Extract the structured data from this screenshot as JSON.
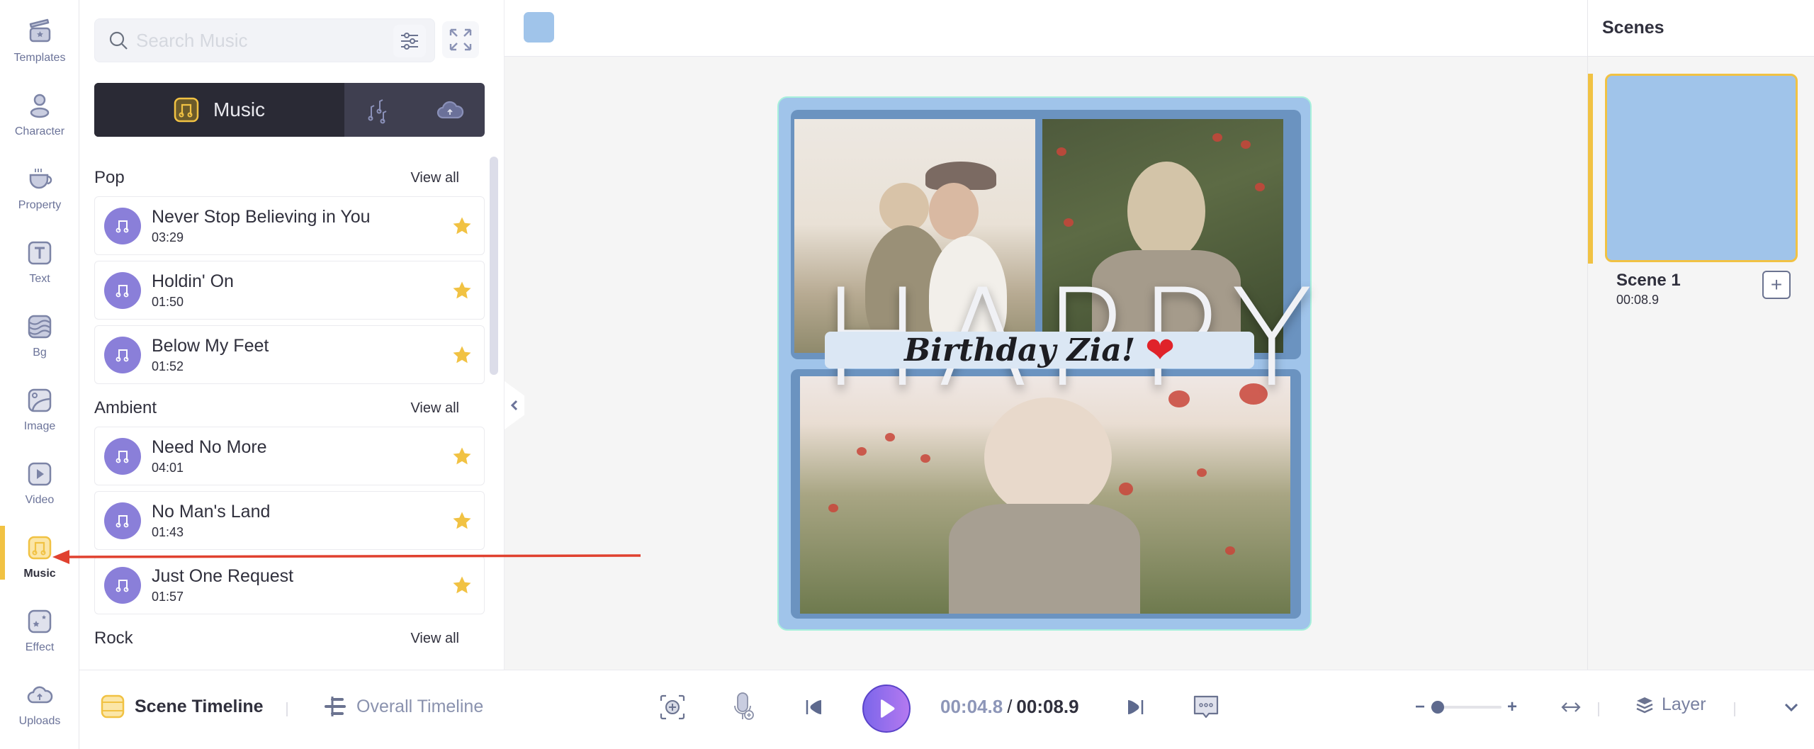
{
  "nav": {
    "items": [
      {
        "label": "Templates",
        "icon": "clapperboard-star-icon",
        "active": false
      },
      {
        "label": "Character",
        "icon": "person-icon",
        "active": false
      },
      {
        "label": "Property",
        "icon": "coffee-cup-icon",
        "active": false
      },
      {
        "label": "Text",
        "icon": "text-t-icon",
        "active": false
      },
      {
        "label": "Bg",
        "icon": "waves-background-icon",
        "active": false
      },
      {
        "label": "Image",
        "icon": "image-icon",
        "active": false
      },
      {
        "label": "Video",
        "icon": "play-video-icon",
        "active": false
      },
      {
        "label": "Music",
        "icon": "music-note-icon",
        "active": true
      },
      {
        "label": "Effect",
        "icon": "sparkle-effect-icon",
        "active": false
      },
      {
        "label": "Uploads",
        "icon": "cloud-upload-icon",
        "active": false
      }
    ]
  },
  "library": {
    "search": {
      "placeholder": "Search Music",
      "value": ""
    },
    "tabs": [
      {
        "label": "Music",
        "icon": "music-note-icon",
        "active": true
      },
      {
        "label": "",
        "icon": "sound-effects-icon",
        "active": false
      },
      {
        "label": "",
        "icon": "cloud-upload-icon",
        "active": false
      }
    ],
    "sections": [
      {
        "title": "Pop",
        "view_all": "View all",
        "tracks": [
          {
            "title": "Never Stop Believing in You",
            "duration": "03:29",
            "starred": true
          },
          {
            "title": "Holdin' On",
            "duration": "01:50",
            "starred": true
          },
          {
            "title": "Below My Feet",
            "duration": "01:52",
            "starred": true
          }
        ]
      },
      {
        "title": "Ambient",
        "view_all": "View all",
        "tracks": [
          {
            "title": "Need No More",
            "duration": "04:01",
            "starred": true
          },
          {
            "title": "No Man's Land",
            "duration": "01:43",
            "starred": true
          },
          {
            "title": "Just One Request",
            "duration": "01:57",
            "starred": true
          }
        ]
      },
      {
        "title": "Rock",
        "view_all": "View all",
        "tracks": []
      }
    ]
  },
  "canvas": {
    "background_color": "#a0c4ea",
    "happy_text": "HAPPY",
    "banner_text": "Birthday Zia!",
    "banner_emoji": "❤"
  },
  "scenes": {
    "title": "Scenes",
    "items": [
      {
        "name": "Scene 1",
        "duration": "00:08.9",
        "selected": true
      }
    ],
    "add_label": "+"
  },
  "bottombar": {
    "scene_timeline": "Scene Timeline",
    "overall_timeline": "Overall Timeline",
    "current_time": "00:04.8",
    "separator": "/",
    "total_time": "00:08.9",
    "zoom_level_fraction": 0.1,
    "zoom_minus": "−",
    "zoom_plus": "+",
    "layer": "Layer"
  },
  "colors": {
    "accent_yellow": "#f1c243",
    "music_purple": "#8a7fd9",
    "play_gradient_start": "#7c66ea",
    "play_gradient_end": "#b479f0",
    "annotation_red": "#e0412f"
  }
}
